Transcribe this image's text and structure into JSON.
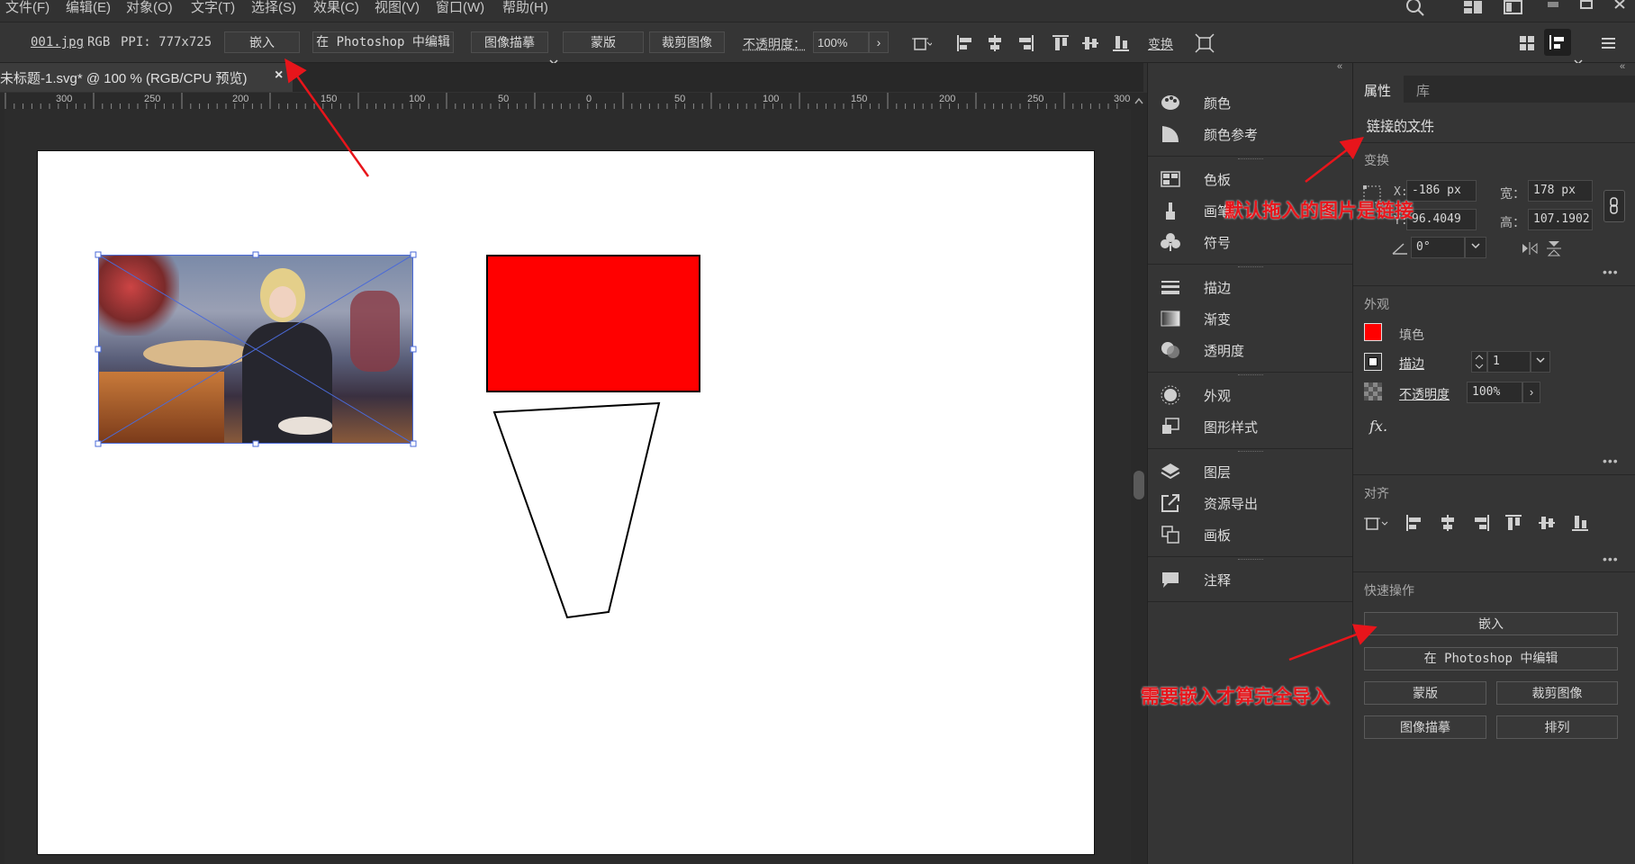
{
  "menubar": {
    "items": [
      "文件(F)",
      "编辑(E)",
      "对象(O)",
      "文字(T)",
      "选择(S)",
      "效果(C)",
      "视图(V)",
      "窗口(W)",
      "帮助(H)"
    ]
  },
  "control_bar": {
    "file_name": "001.jpg",
    "color_mode": "RGB",
    "ppi": "PPI: 777x725",
    "embed_label": "嵌入",
    "edit_ps_label": "在 Photoshop 中编辑",
    "image_trace_label": "图像描摹",
    "mask_label": "蒙版",
    "crop_label": "裁剪图像",
    "opacity_label": "不透明度：",
    "opacity_value": "100%",
    "transform_label": "变换"
  },
  "document_tab": {
    "title": "未标题-1.svg* @ 100 % (RGB/CPU 预览)",
    "close": "×"
  },
  "ruler": {
    "labels": [
      "300",
      "250",
      "200",
      "150",
      "100",
      "50",
      "0",
      "50",
      "100",
      "150",
      "200",
      "250",
      "300"
    ]
  },
  "mid_panel": {
    "items": [
      {
        "label": "颜色",
        "icon": "palette-icon"
      },
      {
        "label": "颜色参考",
        "icon": "color-guide-icon"
      },
      {
        "label": "色板",
        "icon": "swatches-icon"
      },
      {
        "label": "画笔",
        "icon": "brush-icon"
      },
      {
        "label": "符号",
        "icon": "club-icon"
      },
      {
        "label": "描边",
        "icon": "stroke-icon"
      },
      {
        "label": "渐变",
        "icon": "gradient-icon"
      },
      {
        "label": "透明度",
        "icon": "transparency-icon"
      },
      {
        "label": "外观",
        "icon": "appearance-icon"
      },
      {
        "label": "图形样式",
        "icon": "graphic-style-icon"
      },
      {
        "label": "图层",
        "icon": "layers-icon"
      },
      {
        "label": "资源导出",
        "icon": "export-icon"
      },
      {
        "label": "画板",
        "icon": "artboard-icon"
      },
      {
        "label": "注释",
        "icon": "comment-icon"
      }
    ]
  },
  "right_panel": {
    "tabs": [
      "属性",
      "库"
    ],
    "linked_file": "链接的文件",
    "transform_title": "变换",
    "x_label": "X:",
    "x_value": "-186 px",
    "y_label": "Y:",
    "y_value": "96.4049",
    "w_label": "宽：",
    "w_value": "178 px",
    "h_label": "高：",
    "h_value": "107.1902",
    "angle_value": "0°",
    "appearance_title": "外观",
    "fill_label": "填色",
    "stroke_label": "描边",
    "stroke_value": "1",
    "opacity_label": "不透明度",
    "opacity_value": "100%",
    "fx_label": "fx.",
    "align_title": "对齐",
    "quick_title": "快速操作",
    "embed_label": "嵌入",
    "edit_ps_label": "在 Photoshop 中编辑",
    "mask_label": "蒙版",
    "crop_label": "裁剪图像",
    "trace_label": "图像描摹",
    "arrange_label": "排列",
    "dots": "•••"
  },
  "annotations": {
    "linked_note": "默认拖入的图片是链接",
    "embed_note": "需要嵌入才算完全导入"
  },
  "colors": {
    "accent_red": "#ff0000",
    "annotation_red": "#e8151b",
    "ui_dark": "#323232"
  }
}
